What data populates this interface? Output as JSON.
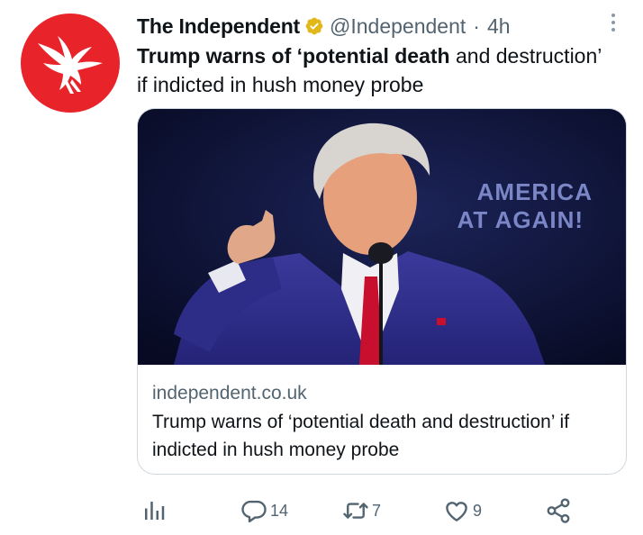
{
  "tweet": {
    "display_name": "The Independent",
    "handle": "@Independent",
    "separator": "·",
    "time": "4h",
    "text_bold": "Trump warns of ‘potential death",
    "text_rest": " and destruction’ if indicted in hush money probe"
  },
  "card": {
    "image_banner_line1": "AMERICA",
    "image_banner_line2": "AT AGAIN!",
    "domain": "independent.co.uk",
    "title": "Trump warns of ‘potential death and destruction’ if indicted in hush money probe"
  },
  "actions": {
    "replies": "14",
    "retweets": "7",
    "likes": "9"
  },
  "colors": {
    "avatar_bg": "#e8232a",
    "verified_gold": "#e2b719",
    "secondary_text": "#536471",
    "card_border": "#cfd9de",
    "icon_gray": "#536471"
  },
  "icons": [
    "eagle-logo",
    "verified-badge-icon",
    "more-options-icon",
    "analytics-icon",
    "reply-icon",
    "retweet-icon",
    "like-icon",
    "share-icon"
  ]
}
